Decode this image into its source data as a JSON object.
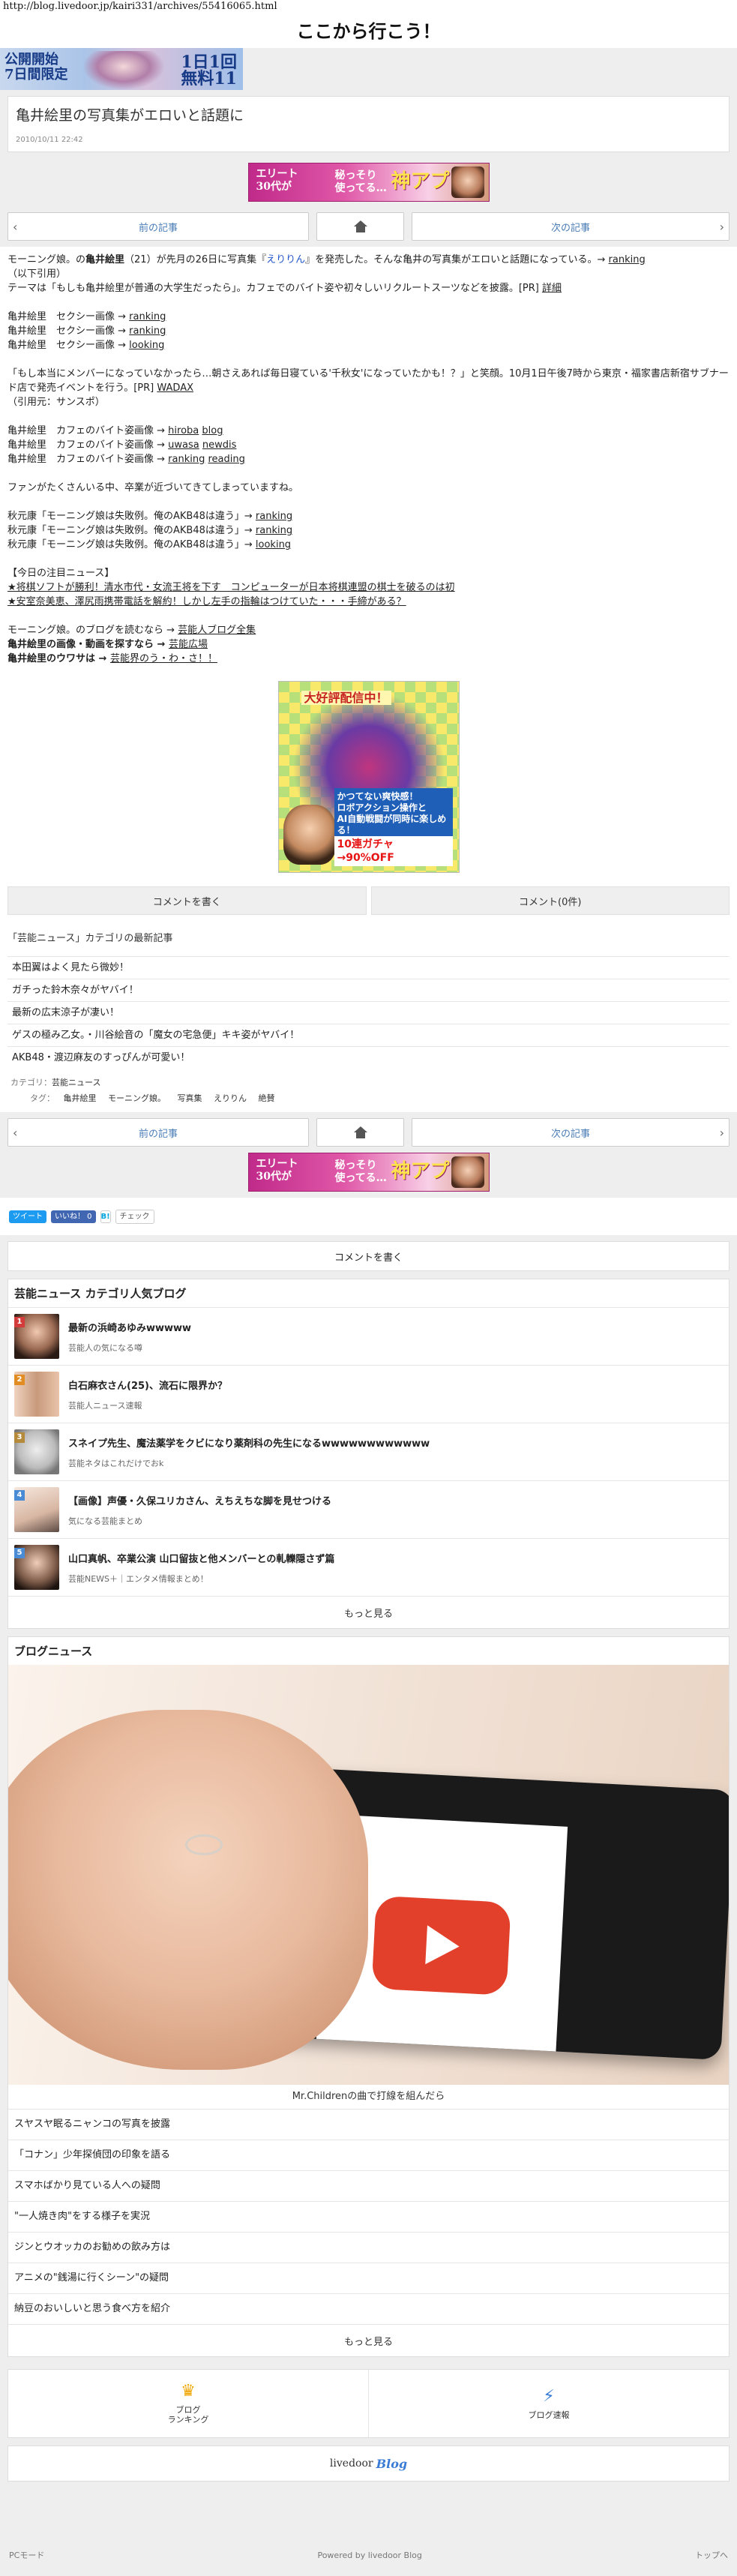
{
  "browser": {
    "url": "http://blog.livedoor.jp/kairi331/archives/55416065.html"
  },
  "site": {
    "title": "ここから行こう！"
  },
  "topbanner": {
    "left_text": "公開開始\n7日間限定",
    "right_text": "1日1回\n無料11"
  },
  "article": {
    "title": "亀井絵里の写真集がエロいと話題に",
    "date": "2010/10/11 22:42"
  },
  "ad": {
    "line1": "エリート\n30代が",
    "line2": "秘っそり\n使ってる…",
    "line3": "神アプリ"
  },
  "pager": {
    "prev": "前の記事",
    "next": "次の記事"
  },
  "body": {
    "p1_a": "モーニング娘。の",
    "p1_b": "亀井絵里",
    "p1_c": "（21）が先月の26日に写真集『",
    "p1_d": "えりりん",
    "p1_e": "』を発売した。そんな亀井の写真集がエロいと話題になっている。→ ",
    "p1_link": "ranking",
    "p2": "（以下引用）",
    "p3_a": "テーマは「もしも亀井絵里が普通の大学生だったら」。カフェでのバイト姿や初々しいリクルートスーツなどを披露。[PR] ",
    "p3_link": "詳細",
    "sexy": [
      {
        "label": "亀井絵里　セクシー画像 → ",
        "link": "ranking"
      },
      {
        "label": "亀井絵里　セクシー画像 → ",
        "link": "ranking"
      },
      {
        "label": "亀井絵里　セクシー画像 → ",
        "link": "looking"
      }
    ],
    "p4_a": "「もし本当にメンバーになっていなかったら…朝さえあれば毎日寝ている'千秋女'になっていたかも！？」と笑顔。10月1日午後7時から東京・福家書店新宿サブナード店で発売イベントを行う。[PR] ",
    "p4_link": "WADAX",
    "p4_b": "（引用元：サンスポ）",
    "cafe": [
      {
        "label": "亀井絵里　カフェのバイト姿画像 → ",
        "l1": "hiroba",
        "l2": "blog"
      },
      {
        "label": "亀井絵里　カフェのバイト姿画像 → ",
        "l1": "uwasa",
        "l2": "newdis"
      },
      {
        "label": "亀井絵里　カフェのバイト姿画像 → ",
        "l1": "ranking",
        "l2": "reading"
      }
    ],
    "p5": "ファンがたくさんいる中、卒業が近づいてきてしまっていますね。",
    "akb": [
      {
        "label": "秋元康「モーニング娘は失敗例。俺のAKB48は違う」→ ",
        "link": "ranking"
      },
      {
        "label": "秋元康「モーニング娘は失敗例。俺のAKB48は違う」→ ",
        "link": "ranking"
      },
      {
        "label": "秋元康「モーニング娘は失敗例。俺のAKB48は違う」→ ",
        "link": "looking"
      }
    ],
    "today_head": "【今日の注目ニュース】",
    "today1": "★将棋ソフトが勝利！清水市代・女流王将を下す　コンピューターが日本将棋連盟の棋士を破るのは初",
    "today2": "★安室奈美恵、澤尻雨携帯電話を解約！しかし左手の指輪はつけていた・・・手締がある？",
    "f1_a": "モーニング娘。のブログを読むなら → ",
    "f1_link": "芸能人ブログ全集",
    "f2_a": "亀井絵里の画像・動画を探すなら → ",
    "f2_link": "芸能広場",
    "f3_a": "亀井絵里のウワサは → ",
    "f3_link": "芸能界のう・わ・さ！！"
  },
  "game_ad": {
    "t1": "大好評配信中！",
    "t2": "かつてない爽快感！\nロボアクション操作と\nAI自動戦闘が同時に楽しめる！",
    "t3": "10連ガチャ→90%OFF"
  },
  "comment": {
    "write": "コメントを書く",
    "count": "コメント(0件)"
  },
  "related": {
    "heading": "「芸能ニュース」カテゴリの最新記事",
    "items": [
      "本田翼はよく見たら微妙！",
      "ガチった鈴木奈々がヤバイ！",
      "最新の広末涼子が凄い！",
      "ゲスの極み乙女。・川谷絵音の「魔女の宅急便」キキ姿がヤバイ！",
      "AKB48・渡辺麻友のすっぴんが可愛い！"
    ]
  },
  "category": {
    "label": "カテゴリ：",
    "value": "芸能ニュース"
  },
  "tags": {
    "label": "タグ：",
    "items": [
      "亀井絵里",
      "モーニング娘。",
      "写真集",
      "えりりん",
      "絶賛"
    ]
  },
  "social": {
    "tweet": "ツイート",
    "like": "いいね！ 0",
    "hatena": "B!",
    "check": "チェック"
  },
  "popular": {
    "heading": "芸能ニュース カテゴリ人気ブログ",
    "items": [
      {
        "rank": "1",
        "title": "最新の浜崎あゆみwwwww",
        "src": "芸能人の気になる噂",
        "color": "#d43b3b"
      },
      {
        "rank": "2",
        "title": "白石麻衣さん(25)、流石に限界か？",
        "src": "芸能人ニュース速報",
        "color": "#e28c24"
      },
      {
        "rank": "3",
        "title": "スネイプ先生、魔法薬学をクビになり薬剤科の先生になるwwwwwwwwwwww",
        "src": "芸能ネタはこれだけでおk",
        "color": "#b58b3b"
      },
      {
        "rank": "4",
        "title": "【画像】声優・久保ユリカさん、えちえちな脚を見せつける",
        "src": "気になる芸能まとめ",
        "color": "#4a8bd6"
      },
      {
        "rank": "5",
        "title": "山口真帆、卒業公演 山口留抜と他メンバーとの軋轢隠さず篇",
        "src": "芸能NEWS＋｜エンタメ情報まとめ！",
        "color": "#4a8bd6"
      }
    ],
    "more": "もっと見る"
  },
  "blognews": {
    "heading": "ブログニュース",
    "caption": "Mr.Childrenの曲で打線を組んだら",
    "items": [
      "スヤスヤ眠るニャンコの写真を披露",
      "「コナン」少年探偵団の印象を語る",
      "スマホばかり見ている人への疑問",
      "\"一人焼き肉\"をする様子を実況",
      "ジンとウオッカのお勧めの飲み方は",
      "アニメの\"銭湯に行くシーン\"の疑問",
      "納豆のおいしいと思う食べ方を紹介"
    ],
    "more": "もっと見る"
  },
  "footer_nav": {
    "ranking": "ブログ\nランキング",
    "speed": "ブログ速報"
  },
  "brand": {
    "livedoor": "livedoor",
    "blog": "Blog"
  },
  "bottom": {
    "pc": "PCモード",
    "powered": "Powered by livedoor Blog",
    "top": "トップへ"
  }
}
